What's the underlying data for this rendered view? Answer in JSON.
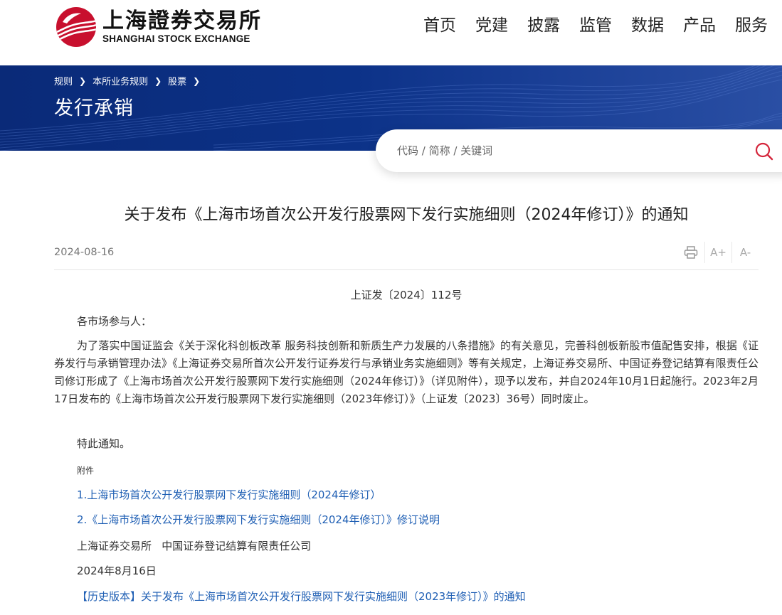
{
  "header": {
    "logo_cn": "上海證券交易所",
    "logo_en": "SHANGHAI STOCK EXCHANGE",
    "nav": [
      "首页",
      "党建",
      "披露",
      "监管",
      "数据",
      "产品",
      "服务"
    ]
  },
  "banner": {
    "breadcrumb": [
      "规则",
      "本所业务规则",
      "股票"
    ],
    "title": "发行承销"
  },
  "search": {
    "placeholder": "代码 / 简称 / 关键词"
  },
  "article": {
    "title": "关于发布《上海市场首次公开发行股票网下发行实施细则（2024年修订）》的通知",
    "date": "2024-08-16",
    "doc_no": "上证发〔2024〕112号",
    "salutation": "各市场参与人：",
    "body": "为了落实中国证监会《关于深化科创板改革 服务科技创新和新质生产力发展的八条措施》的有关意见，完善科创板新股市值配售安排，根据《证券发行与承销管理办法》《上海证券交易所首次公开发行证券发行与承销业务实施细则》等有关规定，上海证券交易所、中国证券登记结算有限责任公司修订形成了《上海市场首次公开发行股票网下发行实施细则（2024年修订）》（详见附件），现予以发布，并自2024年10月1日起施行。2023年2月17日发布的《上海市场首次公开发行股票网下发行实施细则（2023年修订）》（上证发〔2023〕36号）同时废止。",
    "closing": "特此通知。",
    "attachment_label": "附件",
    "attachments": [
      "1.上海市场首次公开发行股票网下发行实施细则（2024年修订）",
      "2.《上海市场首次公开发行股票网下发行实施细则（2024年修订）》修订说明"
    ],
    "signature": "上海证券交易所   中国证券登记结算有限责任公司",
    "sign_date": "2024年8月16日",
    "history_link": "【历史版本】关于发布《上海市场首次公开发行股票网下发行实施细则（2023年修订）》的通知"
  },
  "tools": {
    "print_icon": "printer-icon",
    "font_larger": "A+",
    "font_smaller": "A-"
  },
  "colors": {
    "brand_red": "#c8102e",
    "banner_blue": "#0c3288",
    "link_blue": "#1f5fb4",
    "search_icon": "#d4253b"
  }
}
